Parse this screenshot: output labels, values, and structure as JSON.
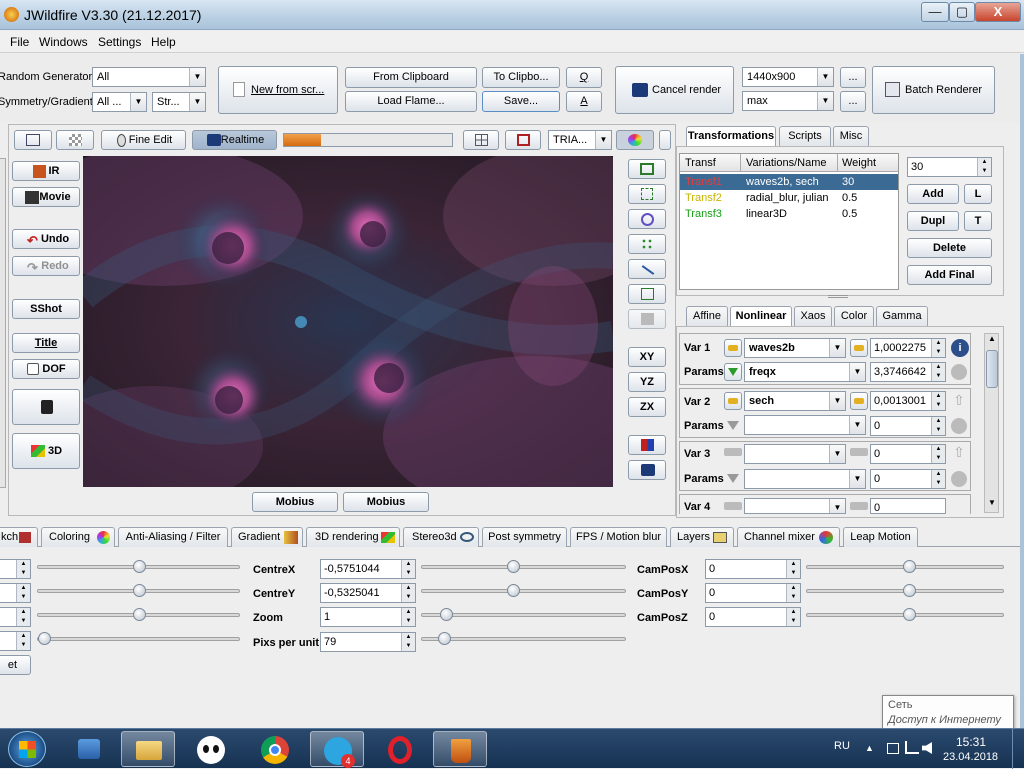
{
  "window": {
    "title": "JWildfire V3.30 (21.12.2017)",
    "min": "—",
    "max": "▢",
    "close": "X"
  },
  "menu": [
    "File",
    "Windows",
    "Settings",
    "Help"
  ],
  "toolbar": {
    "random_generator_label": "Random Generator",
    "random_generator_value": "All",
    "symmetry_label": "Symmetry/Gradient",
    "symmetry_value": "All ...",
    "symmetry_value2": "Str...",
    "new_from_scr": "New from scr...",
    "from_clipboard": "From Clipboard",
    "to_clipboard": "To Clipbo...",
    "q": "Q",
    "load_flame": "Load Flame...",
    "save": "Save...",
    "a": "A",
    "cancel_render": "Cancel render",
    "resolution": "1440x900",
    "quality": "max",
    "more1": "...",
    "more2": "...",
    "batch_renderer": "Batch Renderer"
  },
  "preview_toolbar": {
    "fine_edit": "Fine Edit",
    "realtime": "Realtime",
    "progress": 0.22,
    "mode": "TRIA..."
  },
  "left_buttons": {
    "ir": "IR",
    "movie": "Movie",
    "undo": "Undo",
    "redo": "Redo",
    "sshot": "SShot",
    "title": "Title",
    "dof": "DOF",
    "three_d": "3D"
  },
  "right_tools": {
    "xy": "XY",
    "yz": "YZ",
    "zx": "ZX"
  },
  "mobius": [
    "Mobius",
    "Mobius"
  ],
  "right_tabs": [
    "Transformations",
    "Scripts",
    "Misc"
  ],
  "transforms": {
    "headers": [
      "Transf",
      "Variations/Name",
      "Weight"
    ],
    "rows": [
      {
        "name": "Transf1",
        "vars": "waves2b, sech",
        "weight": "30",
        "color": "#d82020"
      },
      {
        "name": "Transf2",
        "vars": "radial_blur, julian",
        "weight": "0.5",
        "color": "#c8b400"
      },
      {
        "name": "Transf3",
        "vars": "linear3D",
        "weight": "0.5",
        "color": "#19a019"
      }
    ],
    "weight_field": "30",
    "add": "Add",
    "l": "L",
    "dupl": "Dupl",
    "t": "T",
    "delete": "Delete",
    "add_final": "Add Final"
  },
  "sub_tabs": [
    "Affine",
    "Nonlinear",
    "Xaos",
    "Color",
    "Gamma"
  ],
  "vars": [
    {
      "label": "Var 1",
      "name": "waves2b",
      "amount": "1,0002275",
      "params_label": "Params",
      "param": "freqx",
      "param_value": "3,3746642"
    },
    {
      "label": "Var 2",
      "name": "sech",
      "amount": "0,0013001",
      "params_label": "Params",
      "param": "",
      "param_value": "0"
    },
    {
      "label": "Var 3",
      "name": "",
      "amount": "0",
      "params_label": "Params",
      "param": "",
      "param_value": "0"
    },
    {
      "label": "Var 4",
      "name": "",
      "amount": "0"
    }
  ],
  "bottom_tabs": [
    "kch",
    "Coloring",
    "Anti-Aliasing / Filter",
    "Gradient",
    "3D rendering",
    "Stereo3d",
    "Post symmetry",
    "FPS / Motion blur",
    "Layers",
    "Channel mixer",
    "Leap Motion"
  ],
  "bottom_fields": {
    "centre_x": {
      "label": "CentreX",
      "value": "-0,5751044"
    },
    "centre_y": {
      "label": "CentreY",
      "value": "-0,5325041"
    },
    "zoom": {
      "label": "Zoom",
      "value": "1"
    },
    "pixs": {
      "label": "Pixs per unit",
      "value": "79"
    },
    "cam_x": {
      "label": "CamPosX",
      "value": "0"
    },
    "cam_y": {
      "label": "CamPosY",
      "value": "0"
    },
    "cam_z": {
      "label": "CamPosZ",
      "value": "0"
    },
    "reset": "et"
  },
  "tooltip": {
    "line1": "Сеть",
    "line2": "Доступ к Интернету"
  },
  "tray": {
    "lang": "RU",
    "time": "15:31",
    "date": "23.04.2018",
    "telegram_badge": "4"
  }
}
